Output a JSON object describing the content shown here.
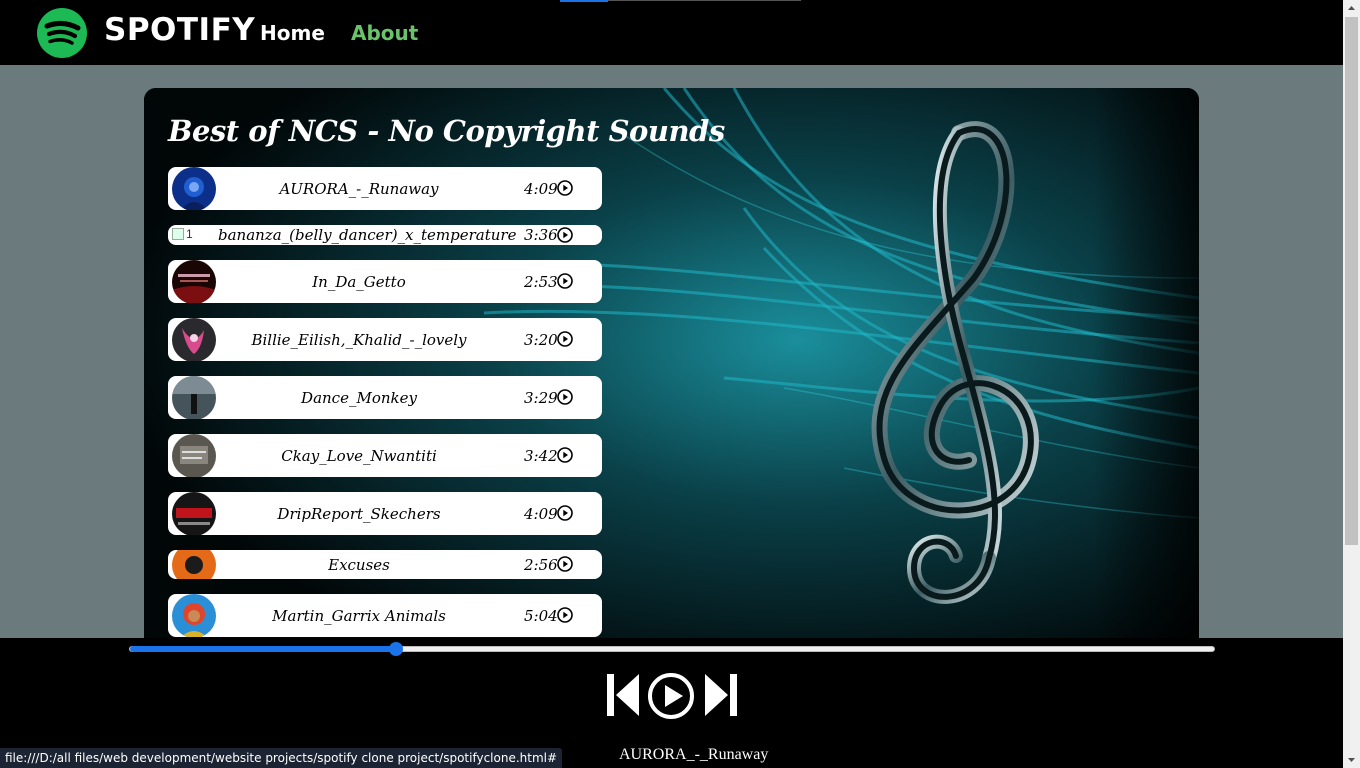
{
  "colors": {
    "brand_green": "#1db954",
    "about_green": "#6ac36b",
    "accent_blue": "#1a73e8",
    "teal": "#17a6b3"
  },
  "nav": {
    "brand": "SPOTIFY",
    "links": [
      {
        "label": "Home"
      },
      {
        "label": "About"
      }
    ]
  },
  "playlist": {
    "title": "Best of NCS - No Copyright Sounds",
    "songs": [
      {
        "name": "AURORA_-_Runaway",
        "duration": "4:09"
      },
      {
        "name": "bananza_(belly_dancer)_x_temperature",
        "duration": "3:36",
        "cover_alt": "1"
      },
      {
        "name": "In_Da_Getto",
        "duration": "2:53"
      },
      {
        "name": "Billie_Eilish,_Khalid_-_lovely",
        "duration": "3:20"
      },
      {
        "name": "Dance_Monkey",
        "duration": "3:29"
      },
      {
        "name": "Ckay_Love_Nwantiti",
        "duration": "3:42"
      },
      {
        "name": "DripReport_Skechers",
        "duration": "4:09"
      },
      {
        "name": "Excuses",
        "duration": "2:56"
      },
      {
        "name": "Martin_Garrix Animals",
        "duration": "5:04"
      }
    ]
  },
  "player": {
    "progress": 0.245,
    "now_playing": "AURORA_-_Runaway",
    "icons": [
      "previous-icon",
      "play-icon",
      "next-icon"
    ]
  },
  "status_bar": {
    "url": "file:///D:/all files/web development/website projects/spotify clone project/spotifyclone.html#"
  }
}
